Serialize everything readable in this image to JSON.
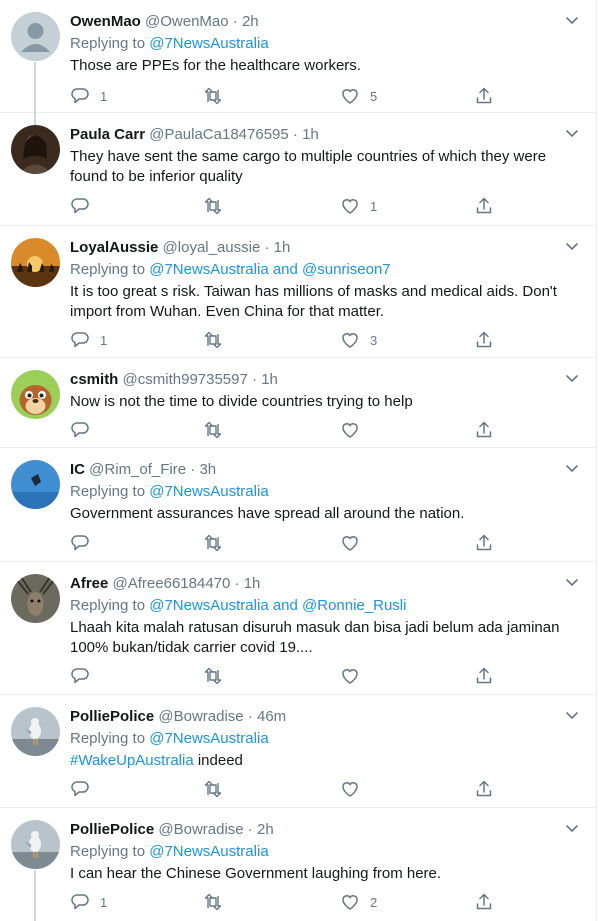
{
  "tweets": [
    {
      "name": "OwenMao",
      "handle": "@OwenMao",
      "time": "2h",
      "replying_prefix": "Replying to ",
      "replying_to": "@7NewsAustralia",
      "text": "Those are PPEs for the healthcare workers.",
      "replies": "1",
      "retweets": "",
      "likes": "5",
      "avatar": "default-avatar"
    },
    {
      "name": "Paula Carr",
      "handle": "@PaulaCa18476595",
      "time": "1h",
      "text": "They have sent the same cargo to multiple countries of which they were found to be inferior quality",
      "replies": "",
      "retweets": "",
      "likes": "1",
      "avatar": "person-avatar"
    },
    {
      "name": "LoyalAussie",
      "handle": "@loyal_aussie",
      "time": "1h",
      "replying_prefix": "Replying to ",
      "replying_to": "@7NewsAustralia and @sunriseon7",
      "text": "It is too great s risk. Taiwan has millions of masks and medical aids. Don't import from Wuhan. Even China for that matter.",
      "replies": "1",
      "retweets": "",
      "likes": "3",
      "avatar": "kangaroos-sunset-avatar"
    },
    {
      "name": "csmith",
      "handle": "@csmith99735597",
      "time": "1h",
      "text": "Now is not the time to divide countries trying to help",
      "replies": "",
      "retweets": "",
      "likes": "",
      "avatar": "chipmunk-avatar"
    },
    {
      "name": "IC",
      "handle": "@Rim_of_Fire",
      "time": "3h",
      "replying_prefix": "Replying to ",
      "replying_to": "@7NewsAustralia",
      "text": "Government assurances have spread all around the nation.",
      "replies": "",
      "retweets": "",
      "likes": "",
      "avatar": "skydiver-avatar"
    },
    {
      "name": "Afree",
      "handle": "@Afree66184470",
      "time": "1h",
      "replying_prefix": "Replying to ",
      "replying_to": "@7NewsAustralia and @Ronnie_Rusli",
      "text": "Lhaah kita malah ratusan disuruh masuk  dan bisa jadi belum ada jaminan 100% bukan/tidak carrier covid 19....",
      "replies": "",
      "retweets": "",
      "likes": "",
      "avatar": "deer-avatar"
    },
    {
      "name": "PolliePolice",
      "handle": "@Bowradise",
      "time": "46m",
      "replying_prefix": "Replying to ",
      "replying_to": "@7NewsAustralia",
      "hashtag": "#WakeUpAustralia",
      "text_after": " indeed",
      "replies": "",
      "retweets": "",
      "likes": "",
      "avatar": "seagull-avatar"
    },
    {
      "name": "PolliePolice",
      "handle": "@Bowradise",
      "time": "2h",
      "replying_prefix": "Replying to ",
      "replying_to": "@7NewsAustralia",
      "text": "I can hear the Chinese Government laughing from here.",
      "replies": "1",
      "retweets": "",
      "likes": "2",
      "avatar": "seagull-avatar"
    }
  ],
  "separator": " · ",
  "colors": {
    "link": "#1b95e0",
    "muted": "#657786",
    "border": "#e6ecf0"
  }
}
